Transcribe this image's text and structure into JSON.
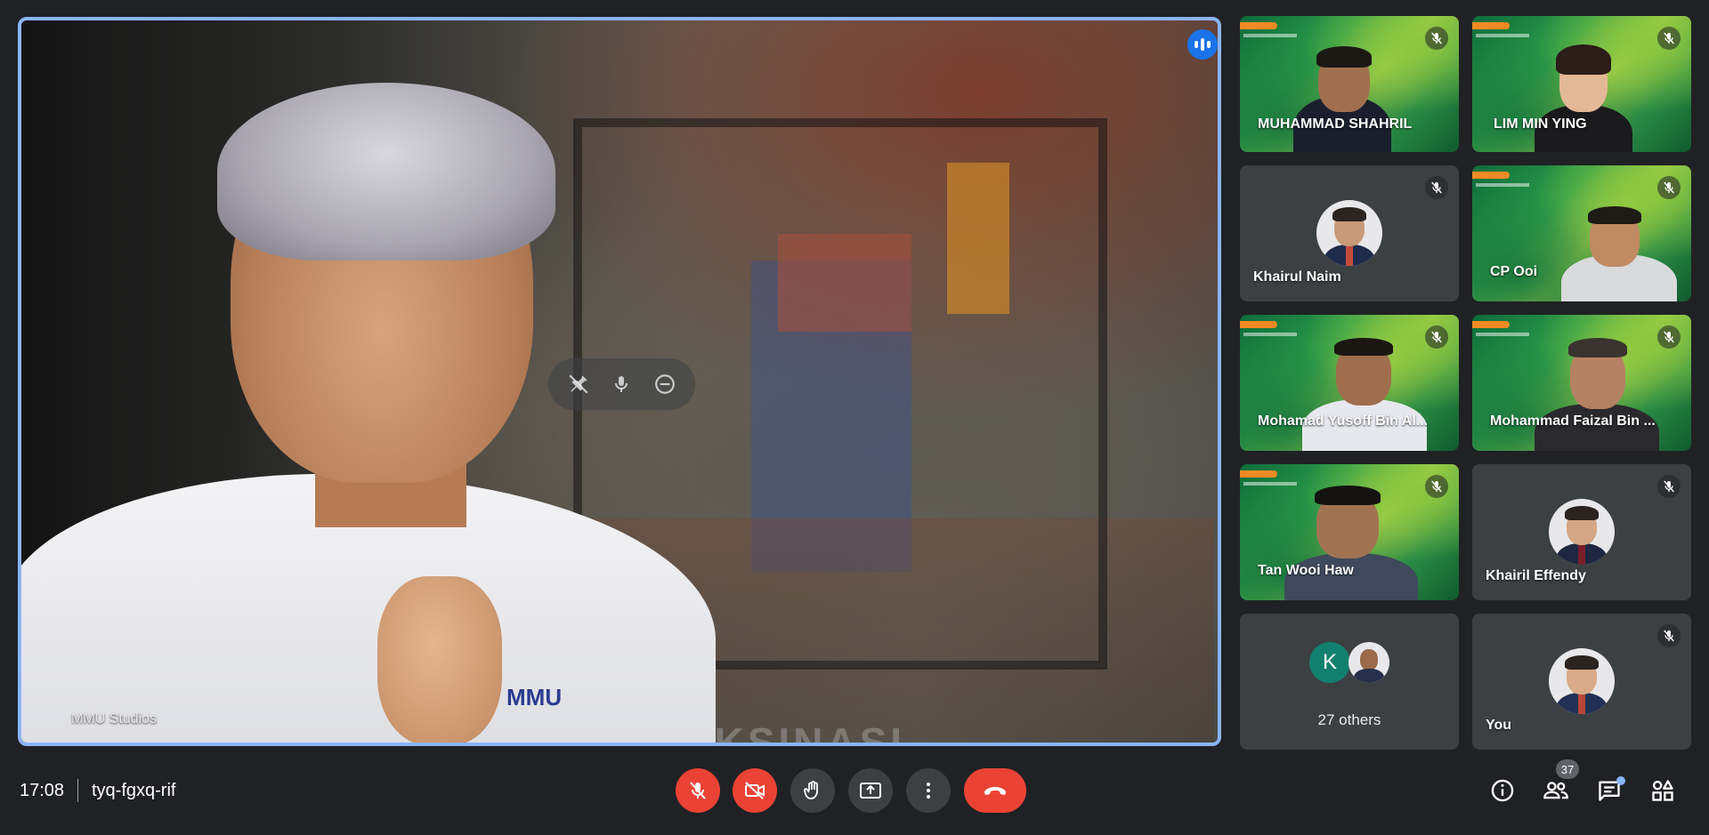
{
  "main": {
    "presenter_name": "MMU Studios",
    "shirt_logo": "MMU",
    "background_text": "VAKSINASI"
  },
  "participants": [
    {
      "name": "MUHAMMAD SHAHRIL",
      "muted": true
    },
    {
      "name": "LIM MIN YING",
      "muted": true
    },
    {
      "name": "Khairul Naim",
      "muted": true
    },
    {
      "name": "CP Ooi",
      "muted": true
    },
    {
      "name": "Mohamad Yusoff Bin Al...",
      "muted": true
    },
    {
      "name": "Mohammad Faizal Bin ...",
      "muted": true
    },
    {
      "name": "Tan Wooi Haw",
      "muted": true
    },
    {
      "name": "Khairil Effendy",
      "muted": true
    },
    {
      "name": "You",
      "muted": true
    }
  ],
  "others": {
    "label": "27 others",
    "initial": "K",
    "initial_color": "#12806f"
  },
  "bottom_bar": {
    "time": "17:08",
    "meeting_code": "tyq-fgxq-rif",
    "participant_count": "37"
  },
  "colors": {
    "accent": "#8ab4f8",
    "danger": "#ea4335",
    "speaking": "#1a73e8",
    "surface": "#3c4043",
    "background": "#202124"
  },
  "icons": {
    "mic_off": "mic-off-icon",
    "camera_off": "camera-off-icon",
    "raise_hand": "raise-hand-icon",
    "present": "present-screen-icon",
    "more": "more-vert-icon",
    "end_call": "end-call-icon",
    "info": "info-icon",
    "people": "people-icon",
    "chat": "chat-icon",
    "activities": "activities-icon"
  }
}
